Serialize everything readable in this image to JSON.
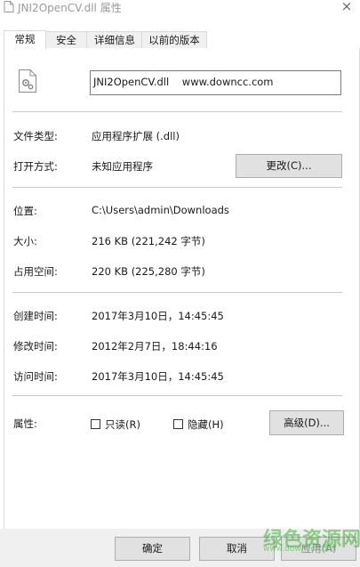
{
  "window": {
    "title": "JNI2OpenCV.dll 属性",
    "close_glyph": "×"
  },
  "tabs": [
    {
      "label": "常规",
      "active": true
    },
    {
      "label": "安全",
      "active": false
    },
    {
      "label": "详细信息",
      "active": false
    },
    {
      "label": "以前的版本",
      "active": false
    }
  ],
  "file": {
    "name": "JNI2OpenCV.dll    www.downcc.com"
  },
  "info": {
    "type_label": "文件类型:",
    "type_value": "应用程序扩展 (.dll)",
    "opens_label": "打开方式:",
    "opens_value": "未知应用程序",
    "change_button": "更改(C)...",
    "location_label": "位置:",
    "location_value": "C:\\Users\\admin\\Downloads",
    "size_label": "大小:",
    "size_value": "216 KB (221,242 字节)",
    "disk_label": "占用空间:",
    "disk_value": "220 KB (225,280 字节)",
    "created_label": "创建时间:",
    "created_value": "2017年3月10日，14:45:45",
    "modified_label": "修改时间:",
    "modified_value": "2012年2月7日，18:44:16",
    "accessed_label": "访问时间:",
    "accessed_value": "2017年3月10日，14:45:45",
    "attributes_label": "属性:",
    "readonly_label": "只读(R)",
    "hidden_label": "隐藏(H)",
    "advanced_button": "高级(D)..."
  },
  "footer": {
    "ok": "确定",
    "cancel": "取消",
    "apply": "应用(A)"
  },
  "watermark": {
    "text": "绿色资源网",
    "url": "www.downcc.com",
    "color": "#3fae3a"
  }
}
